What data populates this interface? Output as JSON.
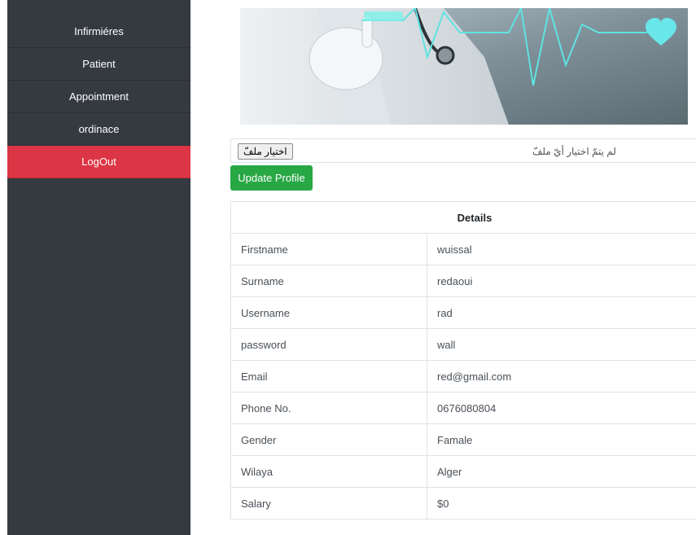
{
  "sidebar": {
    "items": [
      {
        "label": "Infirmiéres"
      },
      {
        "label": "Patient"
      },
      {
        "label": "Appointment"
      },
      {
        "label": "ordinace"
      },
      {
        "label": "LogOut"
      }
    ]
  },
  "upload": {
    "button_label": "اختيار ملفّ",
    "status": "لم يتمّ اختيار أيّ ملفّ"
  },
  "update_button": "Update Profile",
  "details": {
    "header": "Details",
    "rows": [
      {
        "label": "Firstname",
        "value": "wuissal"
      },
      {
        "label": "Surname",
        "value": "redaoui"
      },
      {
        "label": "Username",
        "value": "rad"
      },
      {
        "label": "password",
        "value": "wall"
      },
      {
        "label": "Email",
        "value": "red@gmail.com"
      },
      {
        "label": "Phone No.",
        "value": "0676080804"
      },
      {
        "label": "Gender",
        "value": "Famale"
      },
      {
        "label": "Wilaya",
        "value": "Alger"
      },
      {
        "label": "Salary",
        "value": "$0"
      }
    ]
  },
  "colors": {
    "sidebar_bg": "#343a40",
    "logout_bg": "#dc3545",
    "update_bg": "#28a745",
    "pulse_line": "#5fe3e0"
  },
  "banner_icons": [
    "heart-icon",
    "stethoscope-icon",
    "heartbeat-line"
  ]
}
